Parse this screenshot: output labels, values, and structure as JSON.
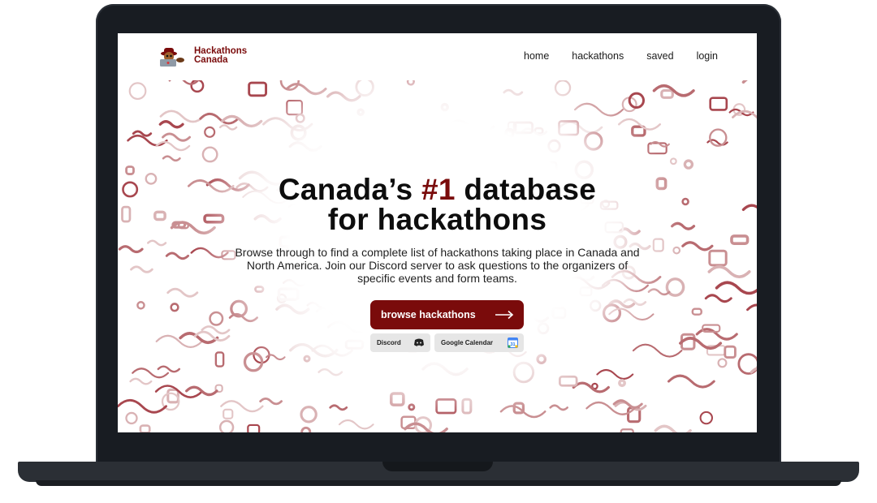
{
  "nav": {
    "brand_line1": "Hackathons",
    "brand_line2": "Canada",
    "links": [
      "home",
      "hackathons",
      "saved",
      "login"
    ]
  },
  "hero": {
    "headline_pre": "Canada’s ",
    "headline_accent": "#1",
    "headline_post": " database",
    "headline_line2": "for hackathons",
    "subtitle": "Browse through to find a complete list of hackathons taking place in Canada and North America. Join our Discord server to ask questions to the organizers of specific events and form teams.",
    "cta_label": "browse hackathons",
    "discord_label": "Discord",
    "calendar_label": "Google Calendar",
    "calendar_icon_text": "31"
  },
  "colors": {
    "brand": "#7a0b0b",
    "laptop_frame": "#181c22",
    "chip_bg": "#e6e6e6"
  },
  "icons": {
    "logo": "beaver-hacker-logo",
    "cta": "arrow-right-icon",
    "discord": "discord-icon",
    "calendar": "google-calendar-icon"
  }
}
